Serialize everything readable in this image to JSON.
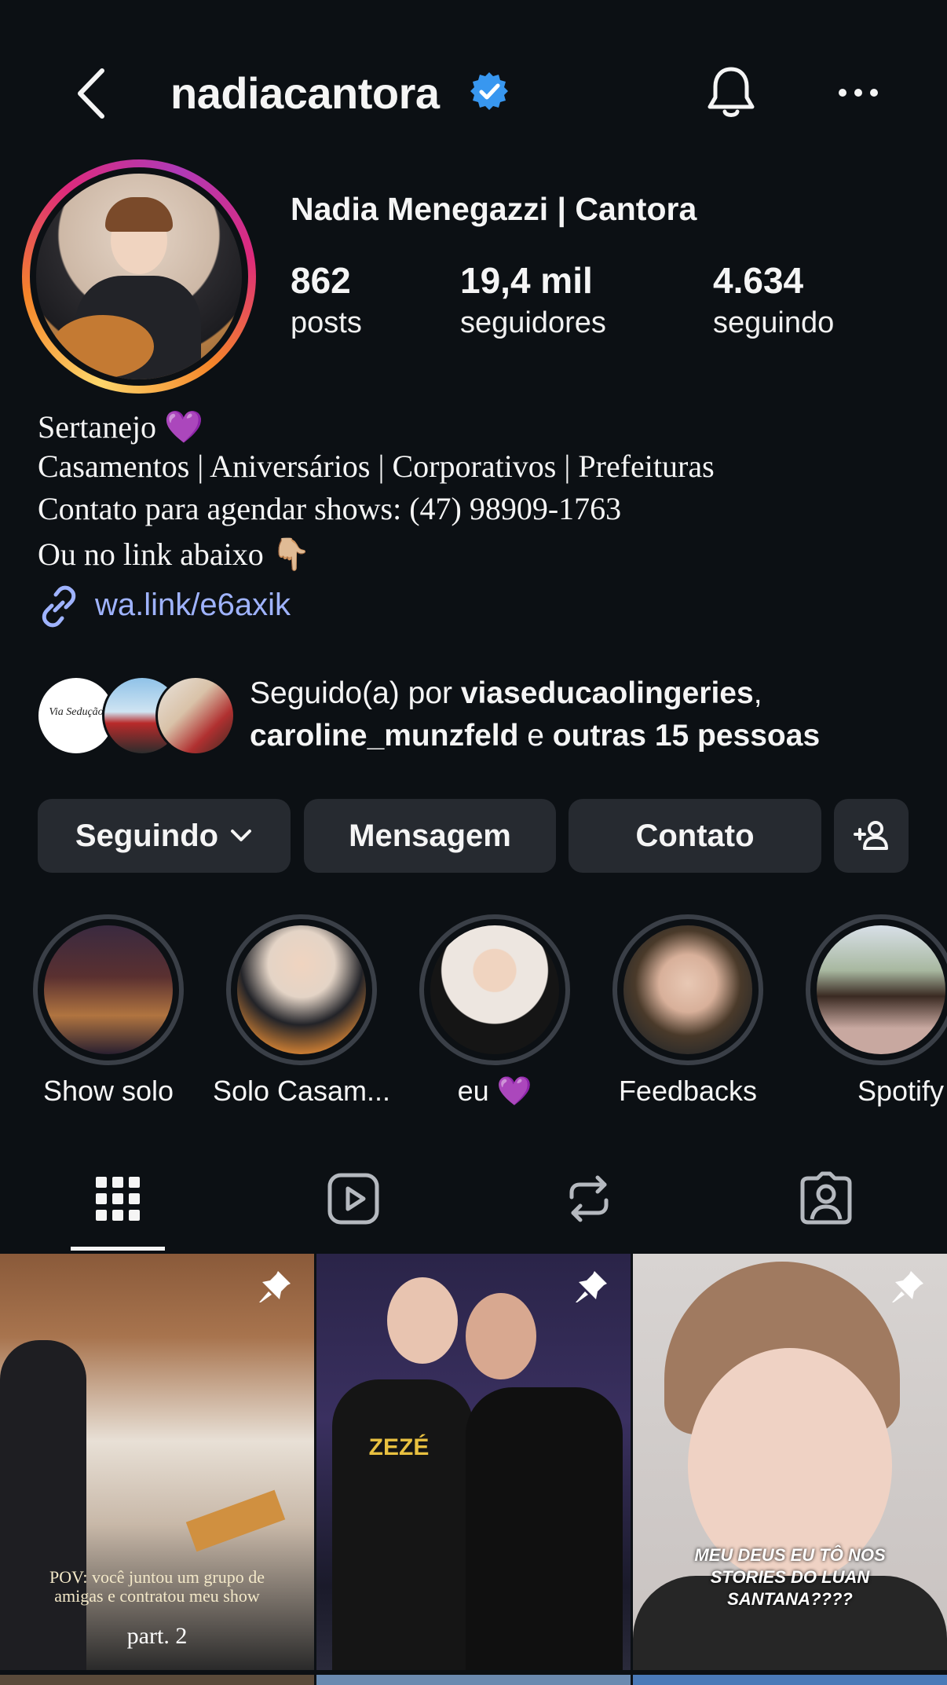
{
  "header": {
    "username": "nadiacantora",
    "back_icon": "chevron-left-icon",
    "verified_icon": "verified-badge-icon",
    "notifications_icon": "bell-icon",
    "more_icon": "more-horizontal-icon"
  },
  "profile": {
    "display_name": "Nadia Menegazzi | Cantora",
    "stats": [
      {
        "value": "862",
        "label": "posts"
      },
      {
        "value": "19,4 mil",
        "label": "seguidores"
      },
      {
        "value": "4.634",
        "label": "seguindo"
      }
    ],
    "bio": [
      "Sertanejo 💜",
      "Casamentos | Aniversários | Corporativos | Prefeituras",
      "Contato para agendar shows: (47) 98909-1763",
      "Ou no link abaixo 👇🏼"
    ],
    "link": "wa.link/e6axik"
  },
  "followed_by": {
    "prefix": "Seguido(a) por ",
    "user1": "viaseducaolingeries",
    "sep": ",",
    "user2": "caroline_munzfeld",
    "conj": " e ",
    "others": "outras 15 pessoas",
    "first_avatar_text": "Via Sedução"
  },
  "actions": {
    "following": "Seguindo",
    "message": "Mensagem",
    "contact": "Contato",
    "add_user_icon": "add-person-icon"
  },
  "highlights": [
    {
      "label": "Show solo"
    },
    {
      "label": "Solo Casam..."
    },
    {
      "label": "eu 💜"
    },
    {
      "label": "Feedbacks"
    },
    {
      "label": "Spotify"
    }
  ],
  "tabs": [
    {
      "icon": "grid-icon",
      "active": true
    },
    {
      "icon": "reels-icon",
      "active": false
    },
    {
      "icon": "reposts-icon",
      "active": false
    },
    {
      "icon": "tagged-icon",
      "active": false
    }
  ],
  "posts": [
    {
      "caption": "POV: você juntou um grupo de amigas e contratou meu show",
      "caption2": "part. 2",
      "pinned": true
    },
    {
      "caption": "ZEZÉ",
      "pinned": true
    },
    {
      "caption": "MEU DEUS EU TÔ NOS STORIES DO LUAN SANTANA????",
      "pinned": true
    }
  ]
}
